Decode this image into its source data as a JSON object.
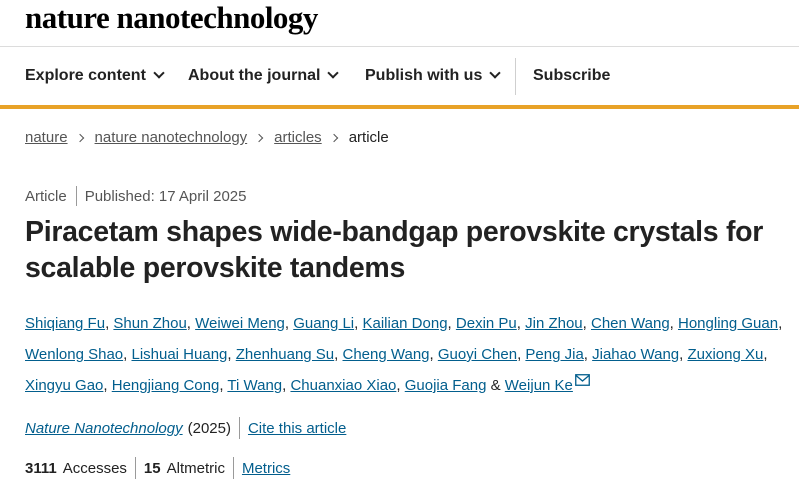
{
  "brand": "nature nanotechnology",
  "nav": {
    "explore": "Explore content",
    "about": "About the journal",
    "publish": "Publish with us",
    "subscribe": "Subscribe"
  },
  "breadcrumb": [
    "nature",
    "nature nanotechnology",
    "articles",
    "article"
  ],
  "article": {
    "type": "Article",
    "published": "Published: 17 April 2025",
    "title_line1": "Piracetam shapes wide-bandgap perovskite crystals for",
    "title_line2": "scalable perovskite tandems"
  },
  "authors": [
    "Shiqiang Fu",
    "Shun Zhou",
    "Weiwei Meng",
    "Guang Li",
    "Kailian Dong",
    "Dexin Pu",
    "Jin Zhou",
    "Chen Wang",
    "Hongling Guan",
    "Wenlong Shao",
    "Lishuai Huang",
    "Zhenhuang Su",
    "Cheng Wang",
    "Guoyi Chen",
    "Peng Jia",
    "Jiahao Wang",
    "Zuxiong Xu",
    "Xingyu Gao",
    "Hengjiang Cong",
    "Ti Wang",
    "Chuanxiao Xiao",
    "Guojia Fang",
    "Weijun Ke"
  ],
  "authors_separator": ", ",
  "authors_last_joiner": " & ",
  "citation": {
    "journal": "Nature Nanotechnology",
    "year": "(2025)",
    "cite_link": "Cite this article"
  },
  "metrics": {
    "accesses_value": "3111",
    "accesses_label": "Accesses",
    "altmetric_value": "15",
    "altmetric_label": "Altmetric",
    "metrics_link": "Metrics"
  },
  "colors": {
    "accent_bar": "#e8a227",
    "link": "#025e8d"
  }
}
